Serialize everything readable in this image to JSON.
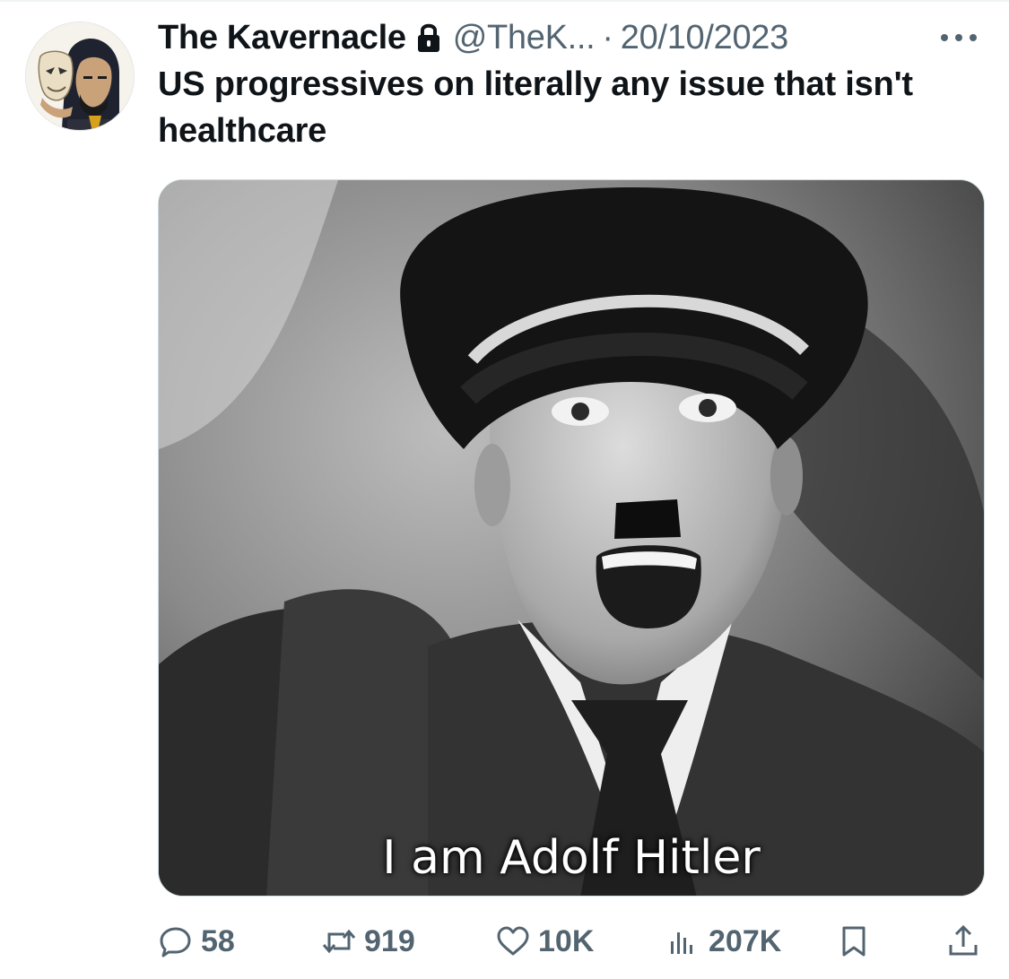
{
  "tweet": {
    "display_name": "The Kavernacle",
    "handle": "@TheK...",
    "separator": "·",
    "date": "20/10/2023",
    "text": "US progressives on literally any issue that isn't healthcare",
    "protected_icon": "lock-icon",
    "more_icon": "more-icon"
  },
  "media": {
    "caption": "I am Adolf Hitler"
  },
  "actions": {
    "replies": "58",
    "retweets": "919",
    "likes": "10K",
    "views": "207K",
    "icons": [
      "reply-icon",
      "retweet-icon",
      "like-icon",
      "views-icon",
      "bookmark-icon",
      "share-icon"
    ]
  },
  "colors": {
    "text_primary": "#0f1419",
    "text_secondary": "#536471",
    "border": "#cfd9de"
  }
}
